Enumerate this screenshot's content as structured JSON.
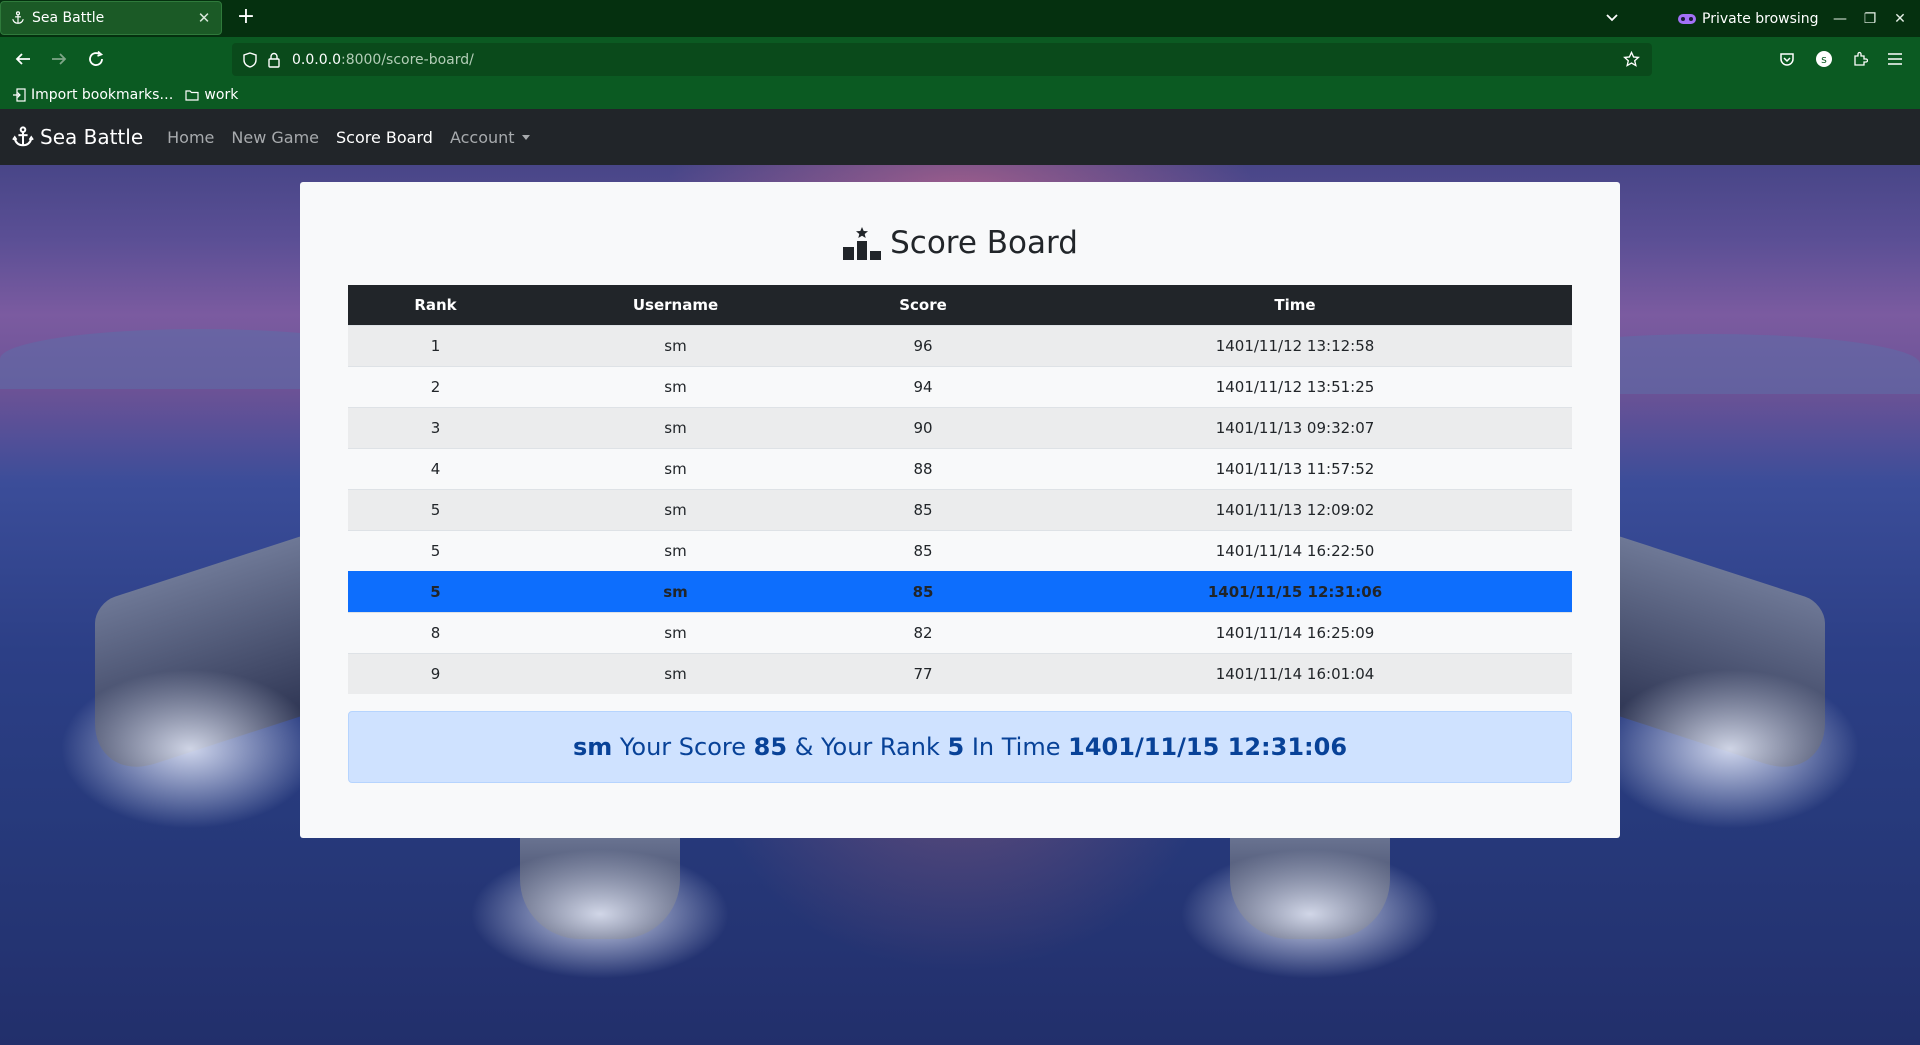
{
  "browser": {
    "tab_title": "Sea Battle",
    "url_host": "0.0.0.0",
    "url_rest": ":8000/score-board/",
    "private_label": "Private browsing",
    "bookmarks": [
      {
        "label": "Import bookmarks…",
        "icon": "import-icon"
      },
      {
        "label": "work",
        "icon": "folder-icon"
      }
    ]
  },
  "site": {
    "brand": "Sea Battle",
    "nav": [
      {
        "label": "Home"
      },
      {
        "label": "New Game"
      },
      {
        "label": "Score Board"
      },
      {
        "label": "Account"
      }
    ]
  },
  "scoreboard": {
    "title": "Score Board",
    "columns": [
      "Rank",
      "Username",
      "Score",
      "Time"
    ],
    "rows": [
      {
        "rank": "1",
        "username": "sm",
        "score": "96",
        "time": "1401/11/12 13:12:58"
      },
      {
        "rank": "2",
        "username": "sm",
        "score": "94",
        "time": "1401/11/12 13:51:25"
      },
      {
        "rank": "3",
        "username": "sm",
        "score": "90",
        "time": "1401/11/13 09:32:07"
      },
      {
        "rank": "4",
        "username": "sm",
        "score": "88",
        "time": "1401/11/13 11:57:52"
      },
      {
        "rank": "5",
        "username": "sm",
        "score": "85",
        "time": "1401/11/13 12:09:02"
      },
      {
        "rank": "5",
        "username": "sm",
        "score": "85",
        "time": "1401/11/14 16:22:50"
      },
      {
        "rank": "5",
        "username": "sm",
        "score": "85",
        "time": "1401/11/15 12:31:06"
      },
      {
        "rank": "8",
        "username": "sm",
        "score": "82",
        "time": "1401/11/14 16:25:09"
      },
      {
        "rank": "9",
        "username": "sm",
        "score": "77",
        "time": "1401/11/14 16:01:04"
      }
    ],
    "summary": {
      "username": "sm",
      "score_prefix": "Your Score",
      "score": "85",
      "rank_prefix": "& Your Rank",
      "rank": "5",
      "time_prefix": "In Time",
      "time": "1401/11/15 12:31:06"
    }
  },
  "colors": {
    "browser_frame": "#0b5a22",
    "navbar": "#212529",
    "highlight_row": "#0d6efd",
    "alert_bg": "#cfe2ff",
    "alert_text": "#084298"
  }
}
